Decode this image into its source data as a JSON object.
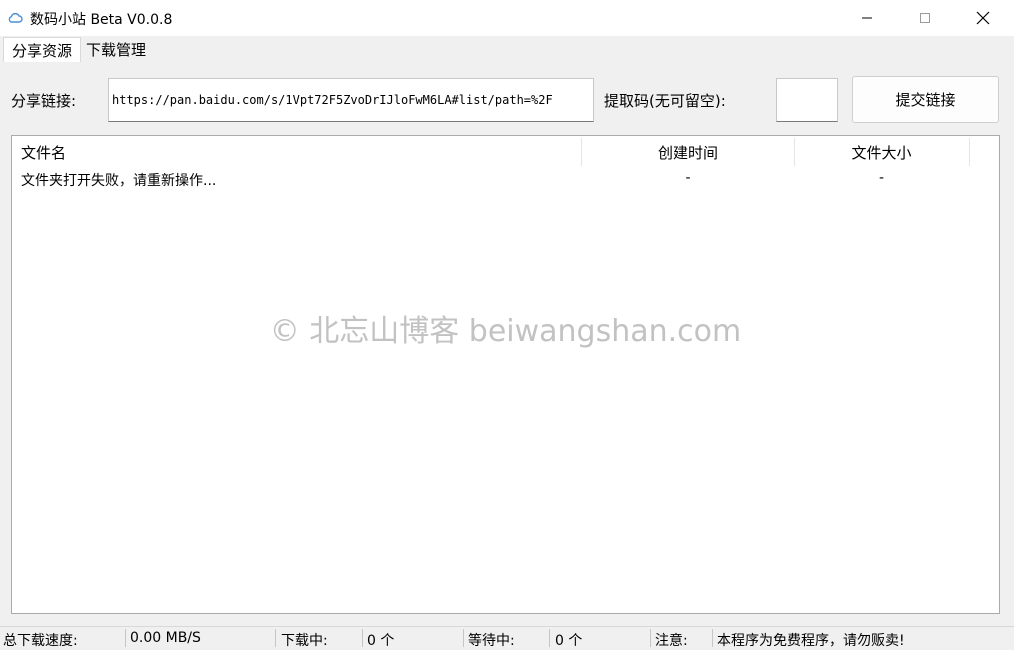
{
  "window": {
    "title": "数码小站 Beta V0.0.8",
    "icon": "cloud-icon",
    "accent_color": "#4a90d9"
  },
  "tabs": [
    {
      "label": "分享资源",
      "active": true
    },
    {
      "label": "下载管理",
      "active": false
    }
  ],
  "share": {
    "link_label": "分享链接:",
    "link_value": "https://pan.baidu.com/s/1Vpt72F5ZvoDrIJloFwM6LA#list/path=%2F",
    "code_label": "提取码(无可留空):",
    "code_value": "",
    "submit_label": "提交链接"
  },
  "list": {
    "columns": [
      "文件名",
      "创建时间",
      "文件大小"
    ],
    "rows": [
      {
        "name": "文件夹打开失败，请重新操作...",
        "created": "-",
        "size": "-"
      }
    ]
  },
  "watermark": "© 北忘山博客 beiwangshan.com",
  "status": {
    "speed_label": "总下载速度:",
    "speed_value": "0.00 MB/S",
    "downloading_label": "下载中:",
    "downloading_value": "0 个",
    "waiting_label": "等待中:",
    "waiting_value": "0 个",
    "notice_label": "注意:",
    "notice_value": "本程序为免费程序，请勿贩卖!"
  }
}
